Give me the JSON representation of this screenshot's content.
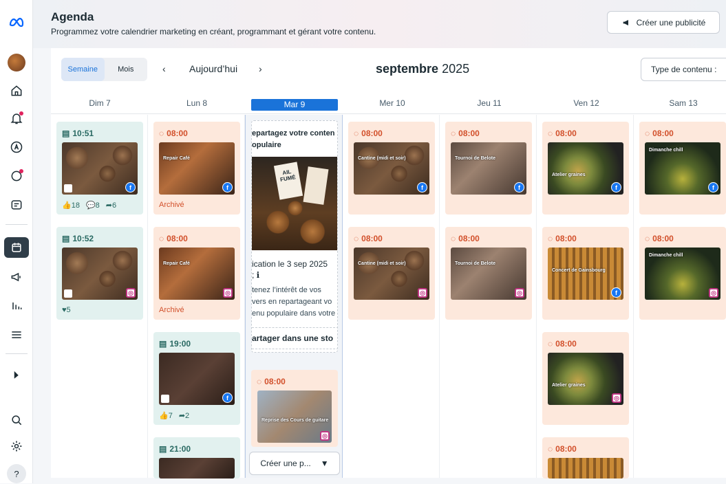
{
  "header": {
    "title": "Agenda",
    "subtitle": "Programmez votre calendrier marketing en créant, programmant et gérant votre contenu.",
    "create_ad": "Créer une publicité"
  },
  "toolbar": {
    "week": "Semaine",
    "month": "Mois",
    "prev": "‹",
    "today": "Aujourd’hui",
    "next": "›",
    "month_name": "septembre",
    "year": "2025",
    "content_type": "Type de contenu :"
  },
  "days": [
    "Dim 7",
    "Lun 8",
    "Mar 9",
    "Mer 10",
    "Jeu 11",
    "Ven 12",
    "Sam 13"
  ],
  "posts": {
    "sun1": {
      "time": "10:51",
      "likes": "18",
      "comments": "8",
      "shares": "6"
    },
    "sun2": {
      "time": "10:52",
      "likes": "5"
    },
    "mon1": {
      "time": "08:00",
      "caption": "Repair Café",
      "status": "Archivé"
    },
    "mon2": {
      "time": "08:00",
      "caption": "Repair Café",
      "status": "Archivé"
    },
    "mon3": {
      "time": "19:00",
      "likes": "7",
      "shares": "2"
    },
    "mon4": {
      "time": "21:00"
    },
    "tue1": {
      "time": "08:00",
      "caption": "Reprise des Cours de guitare"
    },
    "wed1": {
      "time": "08:00",
      "caption": "Cantine (midi et soir)"
    },
    "wed2": {
      "time": "08:00",
      "caption": "Cantine (midi et soir)"
    },
    "thu1": {
      "time": "08:00",
      "caption": "Tournoi de Belote"
    },
    "thu2": {
      "time": "08:00",
      "caption": "Tournoi de Belote"
    },
    "fri1": {
      "time": "08:00",
      "caption": "Atelier graines"
    },
    "fri2": {
      "time": "08:00",
      "caption": "Concert de Gainsbourg"
    },
    "fri3": {
      "time": "08:00",
      "caption": "Atelier graines"
    },
    "fri4": {
      "time": "08:00"
    },
    "sat1": {
      "time": "08:00",
      "caption": "Dimanche chill"
    },
    "sat2": {
      "time": "08:00",
      "caption": "Dimanche chill"
    }
  },
  "share_tip": {
    "line1": "epartagez votre conten",
    "line2": "opulaire",
    "tag": "AIL FUMÉ",
    "line3": "ication le 3 sep 2025",
    "line4": "; ℹ",
    "line5": "tenez l’intérêt de vos",
    "line6": "vers en repartageant vo",
    "line7": "enu populaire dans votre",
    "button": "artager dans une sto"
  },
  "create_post": "Créer une p...",
  "colors": {
    "accent": "#1a73d9",
    "published_bg": "#e2f1ef",
    "scheduled_bg": "#fde8dc",
    "scheduled_text": "#d2502b"
  }
}
